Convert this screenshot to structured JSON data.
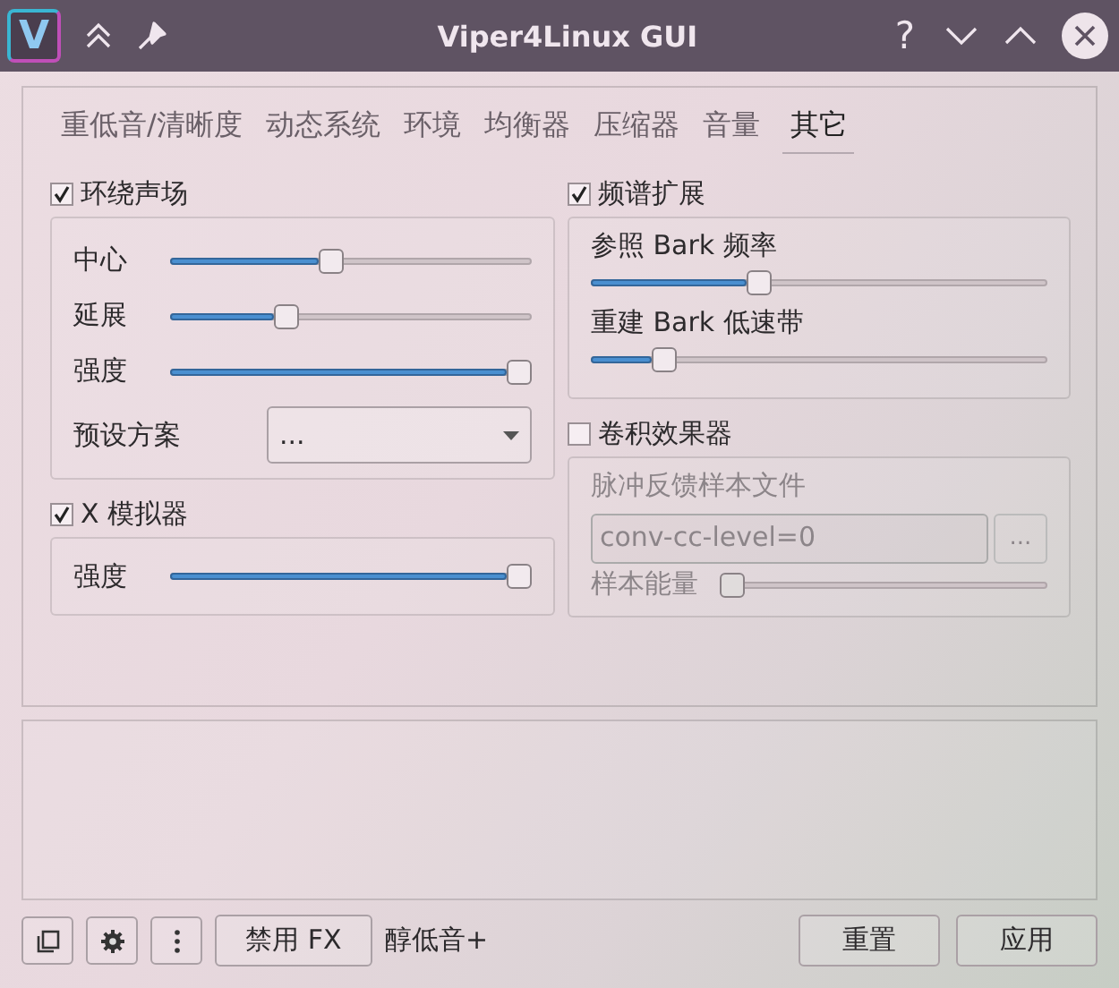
{
  "window": {
    "logo": "V",
    "title": "Viper4Linux GUI",
    "help": "?"
  },
  "tabs": [
    {
      "label": "重低音/清晰度",
      "selected": false
    },
    {
      "label": "动态系统",
      "selected": false
    },
    {
      "label": "环境",
      "selected": false
    },
    {
      "label": "均衡器",
      "selected": false
    },
    {
      "label": "压缩器",
      "selected": false
    },
    {
      "label": "音量",
      "selected": false
    },
    {
      "label": "其它",
      "selected": true
    }
  ],
  "surround": {
    "label": "环绕声场",
    "checked": true,
    "sliders": [
      {
        "label": "中心",
        "level": 0.44
      },
      {
        "label": "延展",
        "level": 0.31
      },
      {
        "label": "强度",
        "level": 1
      }
    ],
    "preset": {
      "label": "预设方案",
      "value": "..."
    }
  },
  "x_simulator": {
    "label": "X 模拟器",
    "checked": true,
    "sliders": [
      {
        "label": "强度",
        "level": 1
      }
    ]
  },
  "spectrum": {
    "label": "频谱扩展",
    "checked": true,
    "sliders": [
      {
        "label": "参照 Bark 频率",
        "level": 0.36
      },
      {
        "label": "重建 Bark 低速带",
        "level": 0.14
      }
    ]
  },
  "convolver": {
    "label": "卷积效果器",
    "checked": false,
    "file_label": "脉冲反馈样本文件",
    "file_value": "conv-cc-level=0",
    "browse": "...",
    "energy": {
      "label": "样本能量",
      "level": 0
    }
  },
  "footer": {
    "disable_button": "禁用 FX",
    "preset_name": "醇低音+",
    "buttons": [
      "重置",
      "应用"
    ]
  }
}
